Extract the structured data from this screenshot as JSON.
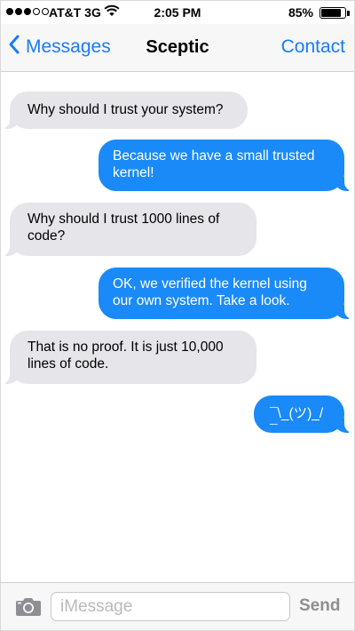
{
  "status_bar": {
    "carrier": "AT&T 3G",
    "time": "2:05 PM",
    "battery": "85%",
    "battery_level": 0.85,
    "signal_bars": 3,
    "signal_total": 5
  },
  "nav": {
    "back_label": "Messages",
    "title": "Sceptic",
    "contact_label": "Contact"
  },
  "messages": [
    {
      "direction": "incoming",
      "text": "Why should I trust your system?"
    },
    {
      "direction": "outgoing",
      "text": "Because we have a small trusted kernel!"
    },
    {
      "direction": "incoming",
      "text": "Why should I trust 1000 lines of code?"
    },
    {
      "direction": "outgoing",
      "text": "OK, we verified the kernel using our own system. Take a look."
    },
    {
      "direction": "incoming",
      "text": "That is no proof. It is just 10,000 lines of code."
    },
    {
      "direction": "outgoing",
      "text": "¯\\_(ツ)_/¯"
    }
  ],
  "composer": {
    "placeholder": "iMessage",
    "value": "",
    "send_label": "Send"
  },
  "colors": {
    "accent": "#1a7cf8",
    "outgoing_bubble": "#1a8af8",
    "incoming_bubble": "#e5e5ea",
    "send_disabled": "#8e8e93"
  },
  "icons": {
    "back": "chevron-left-icon",
    "camera": "camera-icon",
    "wifi": "wifi-icon",
    "battery": "battery-icon"
  }
}
